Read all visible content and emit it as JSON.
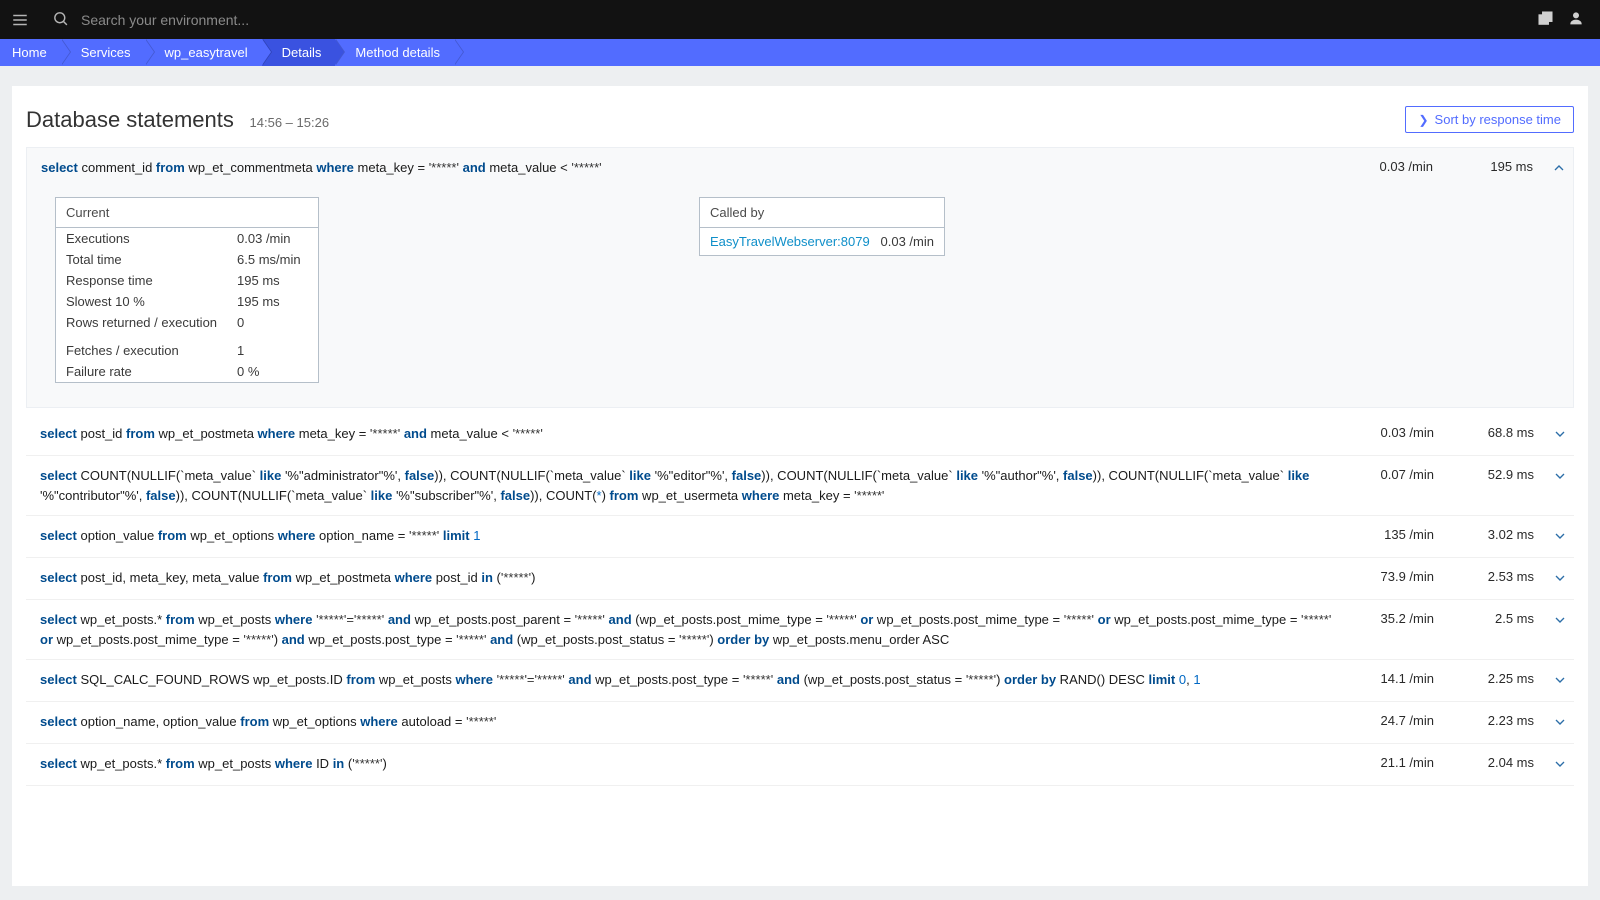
{
  "topbar": {
    "search_placeholder": "Search your environment..."
  },
  "breadcrumbs": [
    "Home",
    "Services",
    "wp_easytravel",
    "Details",
    "Method details"
  ],
  "page": {
    "title": "Database statements",
    "time_range": "14:56 – 15:26",
    "sort_button": "Sort by response time"
  },
  "expanded_detail": {
    "current_label": "Current",
    "rows": [
      {
        "k": "Executions",
        "v": "0.03 /min"
      },
      {
        "k": "Total time",
        "v": "6.5 ms/min"
      },
      {
        "k": "Response time",
        "v": "195 ms"
      },
      {
        "k": "Slowest 10 %",
        "v": "195 ms"
      },
      {
        "k": "Rows returned / execution",
        "v": "0"
      }
    ],
    "rows2": [
      {
        "k": "Fetches / execution",
        "v": "1"
      },
      {
        "k": "Failure rate",
        "v": "0 %"
      }
    ],
    "called_by_label": "Called by",
    "caller_name": "EasyTravelWebserver:8079",
    "caller_rate": "0.03 /min"
  },
  "statements": [
    {
      "sql_tokens": [
        {
          "t": "select",
          "c": "kw"
        },
        {
          "t": " comment_id "
        },
        {
          "t": "from",
          "c": "kw"
        },
        {
          "t": " wp_et_commentmeta "
        },
        {
          "t": "where",
          "c": "kw"
        },
        {
          "t": " meta_key = "
        },
        {
          "t": "'*****'",
          "c": "str"
        },
        {
          "t": " "
        },
        {
          "t": "and",
          "c": "kw"
        },
        {
          "t": " meta_value < "
        },
        {
          "t": "'*****'",
          "c": "str"
        }
      ],
      "rate": "0.03 /min",
      "resp": "195 ms",
      "expanded": true
    },
    {
      "sql_tokens": [
        {
          "t": "select",
          "c": "kw"
        },
        {
          "t": " post_id "
        },
        {
          "t": "from",
          "c": "kw"
        },
        {
          "t": " wp_et_postmeta "
        },
        {
          "t": "where",
          "c": "kw"
        },
        {
          "t": " meta_key = "
        },
        {
          "t": "'*****'",
          "c": "str"
        },
        {
          "t": " "
        },
        {
          "t": "and",
          "c": "kw"
        },
        {
          "t": " meta_value < "
        },
        {
          "t": "'*****'",
          "c": "str"
        }
      ],
      "rate": "0.03 /min",
      "resp": "68.8 ms",
      "expanded": false
    },
    {
      "sql_tokens": [
        {
          "t": "select",
          "c": "kw"
        },
        {
          "t": " COUNT(NULLIF(`meta_value` "
        },
        {
          "t": "like",
          "c": "kw"
        },
        {
          "t": " '%\"administrator\"%', "
        },
        {
          "t": "false",
          "c": "kw"
        },
        {
          "t": ")), COUNT(NULLIF(`meta_value` "
        },
        {
          "t": "like",
          "c": "kw"
        },
        {
          "t": " '%\"editor\"%', "
        },
        {
          "t": "false",
          "c": "kw"
        },
        {
          "t": ")), COUNT(NULLIF(`meta_value` "
        },
        {
          "t": "like",
          "c": "kw"
        },
        {
          "t": " '%\"author\"%', "
        },
        {
          "t": "false",
          "c": "kw"
        },
        {
          "t": ")), COUNT(NULLIF(`meta_value` "
        },
        {
          "t": "like",
          "c": "kw"
        },
        {
          "t": " '%\"contributor\"%', "
        },
        {
          "t": "false",
          "c": "kw"
        },
        {
          "t": ")), COUNT(NULLIF(`meta_value` "
        },
        {
          "t": "like",
          "c": "kw"
        },
        {
          "t": " '%\"subscriber\"%', "
        },
        {
          "t": "false",
          "c": "kw"
        },
        {
          "t": ")), COUNT("
        },
        {
          "t": "*",
          "c": "num"
        },
        {
          "t": ") "
        },
        {
          "t": "from",
          "c": "kw"
        },
        {
          "t": " wp_et_usermeta "
        },
        {
          "t": "where",
          "c": "kw"
        },
        {
          "t": " meta_key = "
        },
        {
          "t": "'*****'",
          "c": "str"
        }
      ],
      "rate": "0.07 /min",
      "resp": "52.9 ms",
      "expanded": false
    },
    {
      "sql_tokens": [
        {
          "t": "select",
          "c": "kw"
        },
        {
          "t": " option_value "
        },
        {
          "t": "from",
          "c": "kw"
        },
        {
          "t": " wp_et_options "
        },
        {
          "t": "where",
          "c": "kw"
        },
        {
          "t": " option_name = "
        },
        {
          "t": "'*****'",
          "c": "str"
        },
        {
          "t": " "
        },
        {
          "t": "limit",
          "c": "kw"
        },
        {
          "t": " "
        },
        {
          "t": "1",
          "c": "num"
        }
      ],
      "rate": "135 /min",
      "resp": "3.02 ms",
      "expanded": false
    },
    {
      "sql_tokens": [
        {
          "t": "select",
          "c": "kw"
        },
        {
          "t": " post_id, meta_key, meta_value "
        },
        {
          "t": "from",
          "c": "kw"
        },
        {
          "t": " wp_et_postmeta "
        },
        {
          "t": "where",
          "c": "kw"
        },
        {
          "t": " post_id "
        },
        {
          "t": "in",
          "c": "kw"
        },
        {
          "t": " ("
        },
        {
          "t": "'*****'",
          "c": "str"
        },
        {
          "t": ")"
        }
      ],
      "rate": "73.9 /min",
      "resp": "2.53 ms",
      "expanded": false
    },
    {
      "sql_tokens": [
        {
          "t": "select",
          "c": "kw"
        },
        {
          "t": " wp_et_posts.* "
        },
        {
          "t": "from",
          "c": "kw"
        },
        {
          "t": " wp_et_posts "
        },
        {
          "t": "where",
          "c": "kw"
        },
        {
          "t": " "
        },
        {
          "t": "'*****'='*****'",
          "c": "str"
        },
        {
          "t": " "
        },
        {
          "t": "and",
          "c": "kw"
        },
        {
          "t": " wp_et_posts.post_parent = "
        },
        {
          "t": "'*****'",
          "c": "str"
        },
        {
          "t": " "
        },
        {
          "t": "and",
          "c": "kw"
        },
        {
          "t": " (wp_et_posts.post_mime_type = "
        },
        {
          "t": "'*****'",
          "c": "str"
        },
        {
          "t": " "
        },
        {
          "t": "or",
          "c": "kw"
        },
        {
          "t": " wp_et_posts.post_mime_type = "
        },
        {
          "t": "'*****'",
          "c": "str"
        },
        {
          "t": " "
        },
        {
          "t": "or",
          "c": "kw"
        },
        {
          "t": " wp_et_posts.post_mime_type = "
        },
        {
          "t": "'*****'",
          "c": "str"
        },
        {
          "t": " "
        },
        {
          "t": "or",
          "c": "kw"
        },
        {
          "t": " wp_et_posts.post_mime_type = "
        },
        {
          "t": "'*****'",
          "c": "str"
        },
        {
          "t": ") "
        },
        {
          "t": "and",
          "c": "kw"
        },
        {
          "t": " wp_et_posts.post_type = "
        },
        {
          "t": "'*****'",
          "c": "str"
        },
        {
          "t": " "
        },
        {
          "t": "and",
          "c": "kw"
        },
        {
          "t": " (wp_et_posts.post_status = "
        },
        {
          "t": "'*****'",
          "c": "str"
        },
        {
          "t": ") "
        },
        {
          "t": "order by",
          "c": "kw"
        },
        {
          "t": " wp_et_posts.menu_order ASC"
        }
      ],
      "rate": "35.2 /min",
      "resp": "2.5 ms",
      "expanded": false,
      "clamp": true
    },
    {
      "sql_tokens": [
        {
          "t": "select",
          "c": "kw"
        },
        {
          "t": " SQL_CALC_FOUND_ROWS wp_et_posts.ID "
        },
        {
          "t": "from",
          "c": "kw"
        },
        {
          "t": " wp_et_posts "
        },
        {
          "t": "where",
          "c": "kw"
        },
        {
          "t": " "
        },
        {
          "t": "'*****'='*****'",
          "c": "str"
        },
        {
          "t": " "
        },
        {
          "t": "and",
          "c": "kw"
        },
        {
          "t": " wp_et_posts.post_type = "
        },
        {
          "t": "'*****'",
          "c": "str"
        },
        {
          "t": " "
        },
        {
          "t": "and",
          "c": "kw"
        },
        {
          "t": " (wp_et_posts.post_status = "
        },
        {
          "t": "'*****'",
          "c": "str"
        },
        {
          "t": ") "
        },
        {
          "t": "order by",
          "c": "kw"
        },
        {
          "t": " RAND() DESC "
        },
        {
          "t": "limit",
          "c": "kw"
        },
        {
          "t": " "
        },
        {
          "t": "0",
          "c": "num"
        },
        {
          "t": ", "
        },
        {
          "t": "1",
          "c": "num"
        }
      ],
      "rate": "14.1 /min",
      "resp": "2.25 ms",
      "expanded": false
    },
    {
      "sql_tokens": [
        {
          "t": "select",
          "c": "kw"
        },
        {
          "t": " option_name, option_value "
        },
        {
          "t": "from",
          "c": "kw"
        },
        {
          "t": " wp_et_options "
        },
        {
          "t": "where",
          "c": "kw"
        },
        {
          "t": " autoload = "
        },
        {
          "t": "'*****'",
          "c": "str"
        }
      ],
      "rate": "24.7 /min",
      "resp": "2.23 ms",
      "expanded": false
    },
    {
      "sql_tokens": [
        {
          "t": "select",
          "c": "kw"
        },
        {
          "t": " wp_et_posts.* "
        },
        {
          "t": "from",
          "c": "kw"
        },
        {
          "t": " wp_et_posts "
        },
        {
          "t": "where",
          "c": "kw"
        },
        {
          "t": " ID "
        },
        {
          "t": "in",
          "c": "kw"
        },
        {
          "t": " ("
        },
        {
          "t": "'*****'",
          "c": "str"
        },
        {
          "t": ")"
        }
      ],
      "rate": "21.1 /min",
      "resp": "2.04 ms",
      "expanded": false
    }
  ]
}
